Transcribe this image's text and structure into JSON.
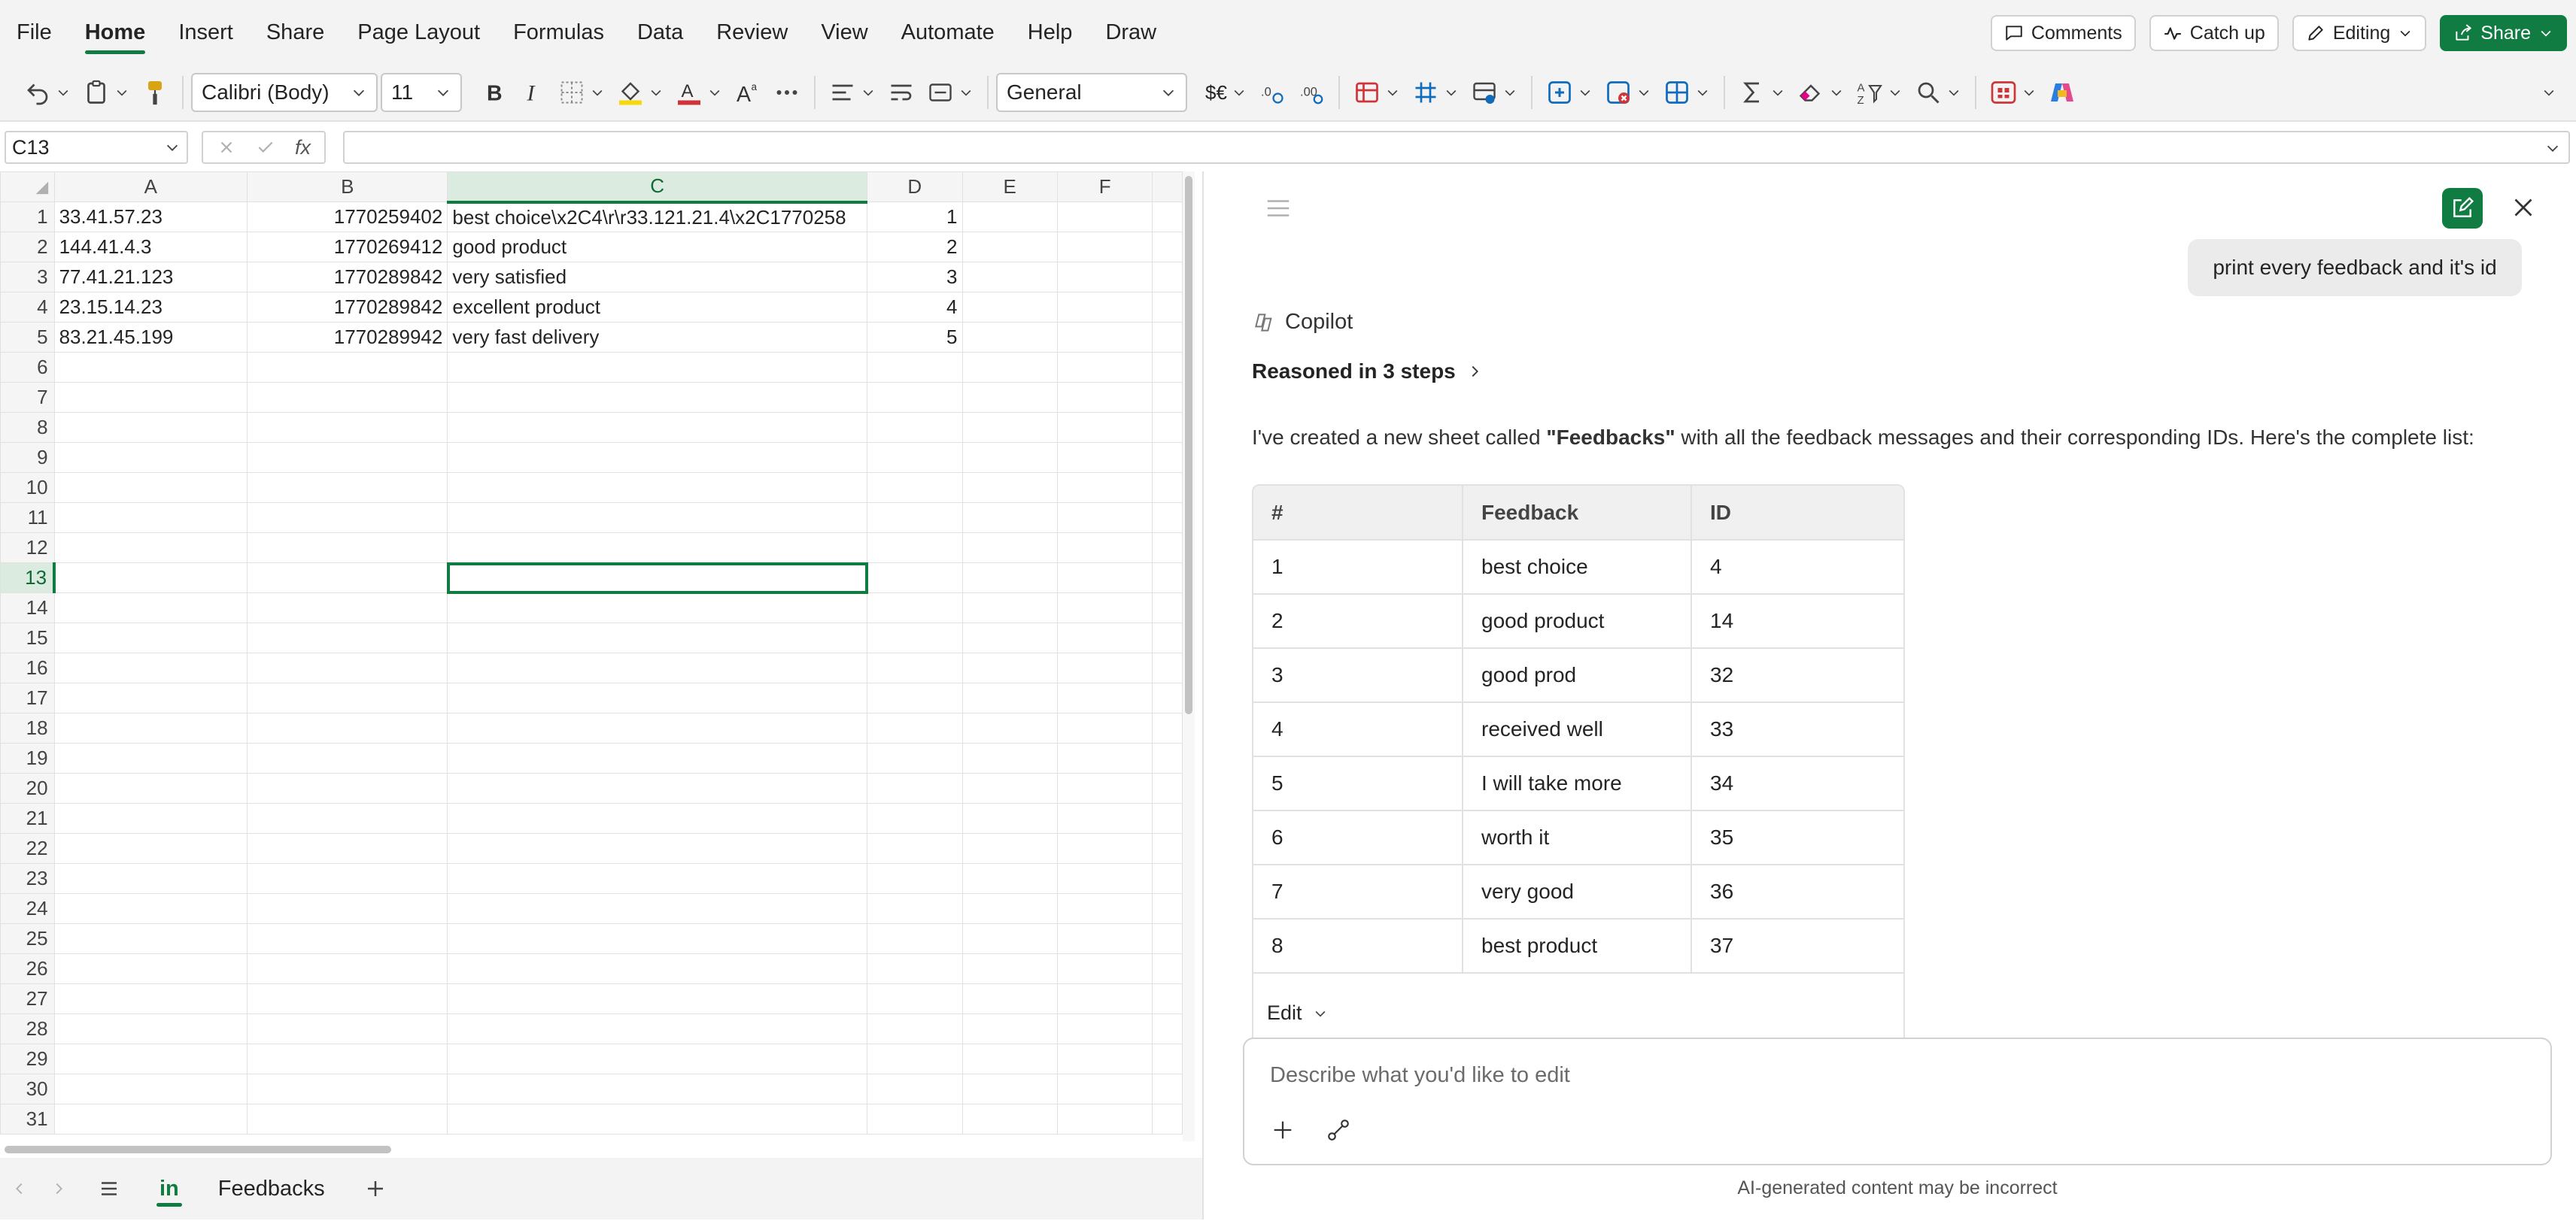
{
  "menu": {
    "items": [
      "File",
      "Home",
      "Insert",
      "Share",
      "Page Layout",
      "Formulas",
      "Data",
      "Review",
      "View",
      "Automate",
      "Help",
      "Draw"
    ],
    "active": "Home",
    "comments": "Comments",
    "catch_up": "Catch up",
    "editing": "Editing",
    "share": "Share"
  },
  "ribbon": {
    "font_name": "Calibri (Body)",
    "font_size": "11",
    "number_format": "General",
    "currency_label": "$€"
  },
  "formula_bar": {
    "name_box": "C13",
    "fx": "fx",
    "formula": ""
  },
  "grid": {
    "columns": [
      "A",
      "B",
      "C",
      "D",
      "E",
      "F"
    ],
    "selected_column": "C",
    "selected_row": 13,
    "row_count": 31,
    "rows": [
      {
        "a": "33.41.57.23",
        "b": "1770259402",
        "c": "best choice\\x2C4\\r\\r33.121.21.4\\x2C1770258",
        "d": "1"
      },
      {
        "a": "144.41.4.3",
        "b": "1770269412",
        "c": "good product",
        "d": "2"
      },
      {
        "a": "77.41.21.123",
        "b": "1770289842",
        "c": "very satisfied",
        "d": "3"
      },
      {
        "a": "23.15.14.23",
        "b": "1770289842",
        "c": "excellent product",
        "d": "4"
      },
      {
        "a": "83.21.45.199",
        "b": "1770289942",
        "c": "very fast delivery",
        "d": "5"
      }
    ]
  },
  "sheet_tabs": {
    "tabs": [
      "in",
      "Feedbacks"
    ],
    "active": "in"
  },
  "copilot": {
    "user_message": "print every feedback and it's id",
    "name": "Copilot",
    "reasoned": "Reasoned in 3 steps",
    "message_before": "I've created a new sheet called ",
    "message_sheet": "\"Feedbacks\"",
    "message_after": " with all the feedback messages and their corresponding IDs. Here's the complete list:",
    "table_headers": [
      "#",
      "Feedback",
      "ID"
    ],
    "table_rows": [
      [
        "1",
        "best choice",
        "4"
      ],
      [
        "2",
        "good product",
        "14"
      ],
      [
        "3",
        "good prod",
        "32"
      ],
      [
        "4",
        "received well",
        "33"
      ],
      [
        "5",
        "I will take more",
        "34"
      ],
      [
        "6",
        "worth it",
        "35"
      ],
      [
        "7",
        "very good",
        "36"
      ],
      [
        "8",
        "best product",
        "37"
      ]
    ],
    "edit_label": "Edit",
    "input_placeholder": "Describe what you'd like to edit",
    "disclaimer": "AI-generated content may be incorrect"
  }
}
